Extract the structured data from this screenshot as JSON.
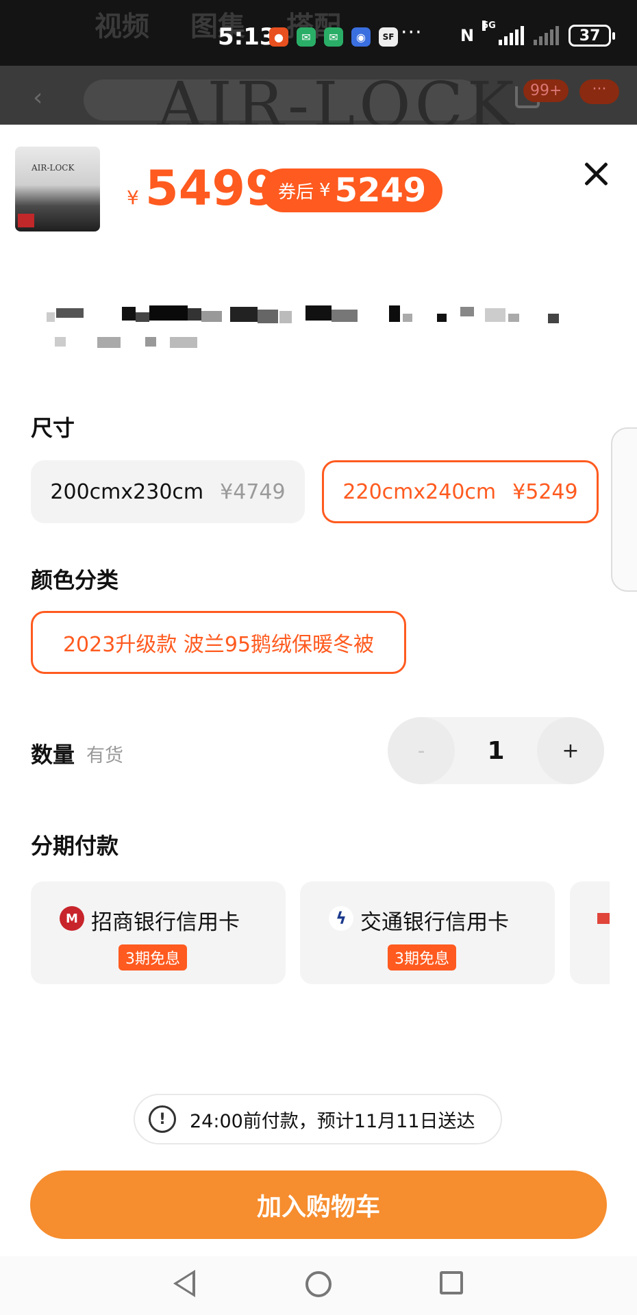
{
  "status_bar": {
    "time": "5:13",
    "battery": "37",
    "network": "5G",
    "more": "···",
    "nfc": "N",
    "app_icons": [
      "taobao-icon",
      "wechat-icon",
      "wechat-icon",
      "app-icon",
      "sf-express-icon"
    ]
  },
  "background_page": {
    "tabs": [
      "视频",
      "图集",
      "搭配"
    ],
    "watermark": "AIR-LOCK",
    "cart_badge": "99+",
    "more_label": "···"
  },
  "product": {
    "price_symbol": "¥",
    "price": "5499",
    "coupon_label": "券后",
    "coupon_symbol": "¥",
    "coupon_price": "5249",
    "thumb_logo": "AIR-LOCK"
  },
  "size": {
    "title": "尺寸",
    "options": [
      {
        "label": "200cmx230cm",
        "price": "¥4749",
        "selected": false
      },
      {
        "label": "220cmx240cm",
        "price": "¥5249",
        "selected": true
      }
    ]
  },
  "color": {
    "title": "颜色分类",
    "options": [
      {
        "label": "2023升级款 波兰95鹅绒保暖冬被",
        "selected": true
      }
    ]
  },
  "quantity": {
    "title": "数量",
    "stock": "有货",
    "minus": "-",
    "value": "1",
    "plus": "+"
  },
  "installment": {
    "title": "分期付款",
    "cards": [
      {
        "name": "招商银行信用卡",
        "tag": "3期免息"
      },
      {
        "name": "交通银行信用卡",
        "tag": "3期免息"
      }
    ]
  },
  "notice": {
    "icon": "!",
    "text": "24:00前付款，预计11月11日送达"
  },
  "actions": {
    "add_to_cart": "加入购物车"
  },
  "colors": {
    "accent": "#ff5a1f",
    "cart_button": "#f68d2e"
  }
}
